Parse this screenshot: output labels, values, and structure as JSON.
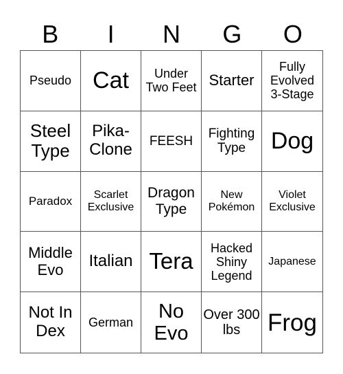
{
  "header": {
    "letters": [
      "B",
      "I",
      "N",
      "G",
      "O"
    ]
  },
  "cells": [
    {
      "text": "Pseudo",
      "size": "s18"
    },
    {
      "text": "Cat",
      "size": "s34"
    },
    {
      "text": "Under Two Feet",
      "size": "s18"
    },
    {
      "text": "Starter",
      "size": "s22"
    },
    {
      "text": "Fully Evolved 3-Stage",
      "size": "s18"
    },
    {
      "text": "Steel Type",
      "size": "s26"
    },
    {
      "text": "Pika-Clone",
      "size": "s24"
    },
    {
      "text": "FEESH",
      "size": "s19"
    },
    {
      "text": "Fighting Type",
      "size": "s19"
    },
    {
      "text": "Dog",
      "size": "s34"
    },
    {
      "text": "Paradox",
      "size": "s17"
    },
    {
      "text": "Scarlet Exclusive",
      "size": "s16"
    },
    {
      "text": "Dragon Type",
      "size": "s21"
    },
    {
      "text": "New Pokémon",
      "size": "s16"
    },
    {
      "text": "Violet Exclusive",
      "size": "s16"
    },
    {
      "text": "Middle Evo",
      "size": "s22"
    },
    {
      "text": "Italian",
      "size": "s24"
    },
    {
      "text": "Tera",
      "size": "s33"
    },
    {
      "text": "Hacked Shiny Legend",
      "size": "s18"
    },
    {
      "text": "Japanese",
      "size": "s16"
    },
    {
      "text": "Not In Dex",
      "size": "s24"
    },
    {
      "text": "German",
      "size": "s18"
    },
    {
      "text": "No Evo",
      "size": "s29"
    },
    {
      "text": "Over 300 lbs",
      "size": "s20"
    },
    {
      "text": "Frog",
      "size": "s35"
    }
  ]
}
